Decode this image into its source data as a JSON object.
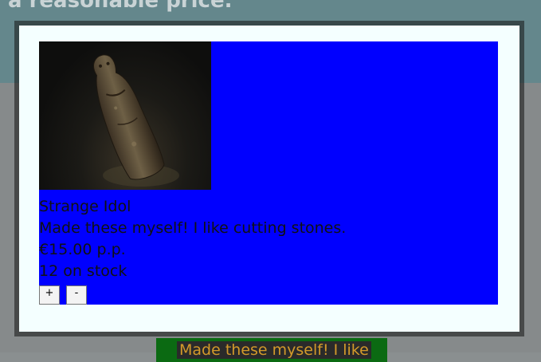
{
  "background": {
    "header_title": "a reasonable price.",
    "card_text": "Made these myself! I like"
  },
  "modal": {
    "image_icon": "stone-idol-image",
    "product": {
      "name": "Strange Idol",
      "description": "Made these myself! I like cutting stones.",
      "price": "€15.00 p.p.",
      "stock": "12 on stock"
    },
    "increment_label": "+",
    "decrement_label": "-"
  },
  "colors": {
    "modal_background": "#f4ffff",
    "content_background": "#0000ff",
    "header_background": "#64878c",
    "card_background": "#0b6a12"
  }
}
